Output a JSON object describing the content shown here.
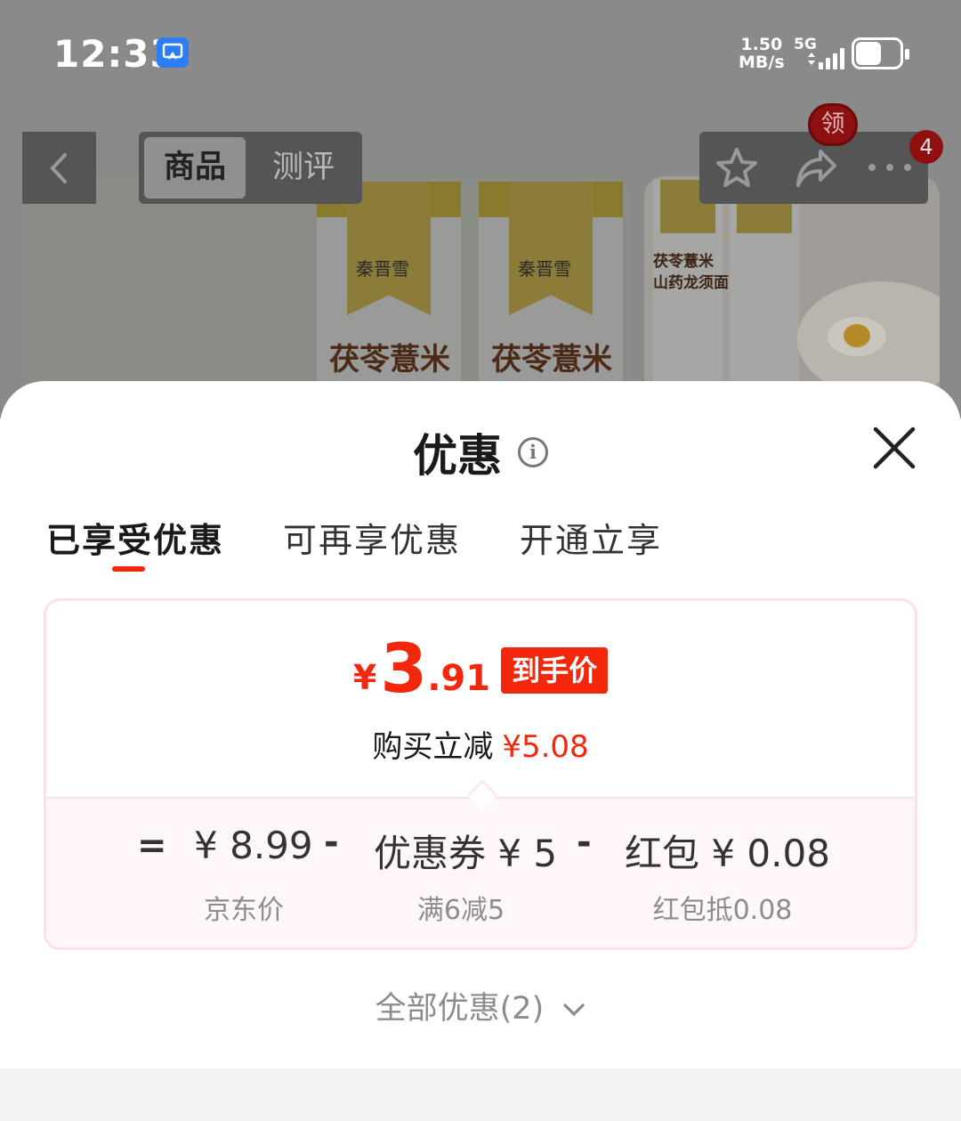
{
  "status": {
    "time": "12:33",
    "net_speed_value": "1.50",
    "net_speed_unit": "MB/s",
    "network": "5G"
  },
  "product_tabs": {
    "goods": "商品",
    "review": "测评"
  },
  "header": {
    "coupon_label": "领",
    "cart_badge": "4"
  },
  "product": {
    "brand": "秦晋雪",
    "name": "茯苓薏米",
    "name2_line1": "茯苓薏米",
    "name2_line2": "山药龙须面"
  },
  "sheet": {
    "title": "优惠",
    "tabs": [
      "已享受优惠",
      "可再享优惠",
      "开通立享"
    ],
    "price": {
      "currency": "¥",
      "integer": "3",
      "decimal": ".91",
      "tag": "到手价"
    },
    "saving_label": "购买立减",
    "saving_amount": "¥5.08",
    "breakdown": {
      "equals": "=",
      "minus": "-",
      "base_price": "¥ 8.99",
      "base_label": "京东价",
      "coupon": "优惠券 ¥ 5",
      "coupon_label": "满6减5",
      "redpacket": "红包 ¥ 0.08",
      "redpacket_label": "红包抵0.08"
    },
    "all_offers": "全部优惠(2)"
  },
  "colors": {
    "accent": "#f2270c",
    "card_border": "#fde1e6",
    "card_bg": "#fff6f7"
  }
}
